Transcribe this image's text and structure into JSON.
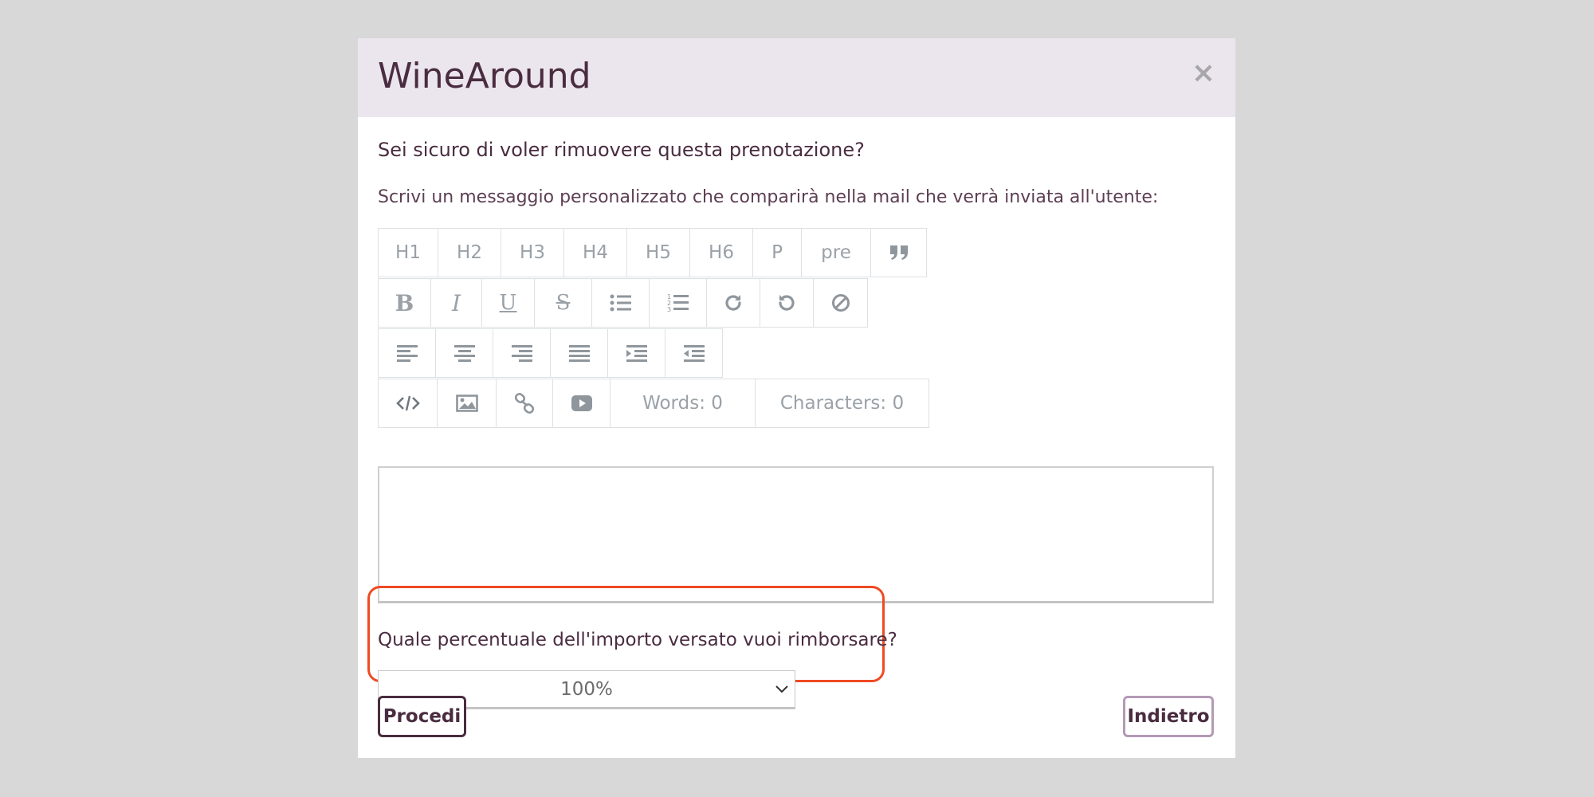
{
  "modal": {
    "title": "WineAround",
    "close_symbol": "×",
    "question": "Sei sicuro di voler rimuovere questa prenotazione?",
    "hint": "Scrivi un messaggio personalizzato che comparirà nella mail che verrà inviata all'utente:"
  },
  "toolbar": {
    "headings": [
      "H1",
      "H2",
      "H3",
      "H4",
      "H5",
      "H6",
      "P",
      "pre"
    ],
    "quote_icon": "quote-icon",
    "format_icons": [
      "bold-icon",
      "italic-icon",
      "underline-icon",
      "strikethrough-icon",
      "unordered-list-icon",
      "ordered-list-icon",
      "redo-icon",
      "undo-icon",
      "clear-format-icon"
    ],
    "align_icons": [
      "align-left-icon",
      "align-center-icon",
      "align-right-icon",
      "align-justify-icon",
      "indent-icon",
      "outdent-icon"
    ],
    "insert_icons": [
      "code-view-icon",
      "image-icon",
      "link-icon",
      "video-icon"
    ],
    "words_label": "Words: 0",
    "chars_label": "Characters: 0"
  },
  "editor": {
    "value": ""
  },
  "refund": {
    "label": "Quale percentuale dell'importo versato vuoi rimborsare?",
    "selected": "100%"
  },
  "actions": {
    "proceed": "Procedi",
    "back": "Indietro"
  },
  "colors": {
    "header_bg": "#ebe6ed",
    "text": "#4a2c40",
    "highlight_border": "#f04a23",
    "toolbar_icon": "#9aa1a7",
    "back_border": "#b39ab5"
  }
}
